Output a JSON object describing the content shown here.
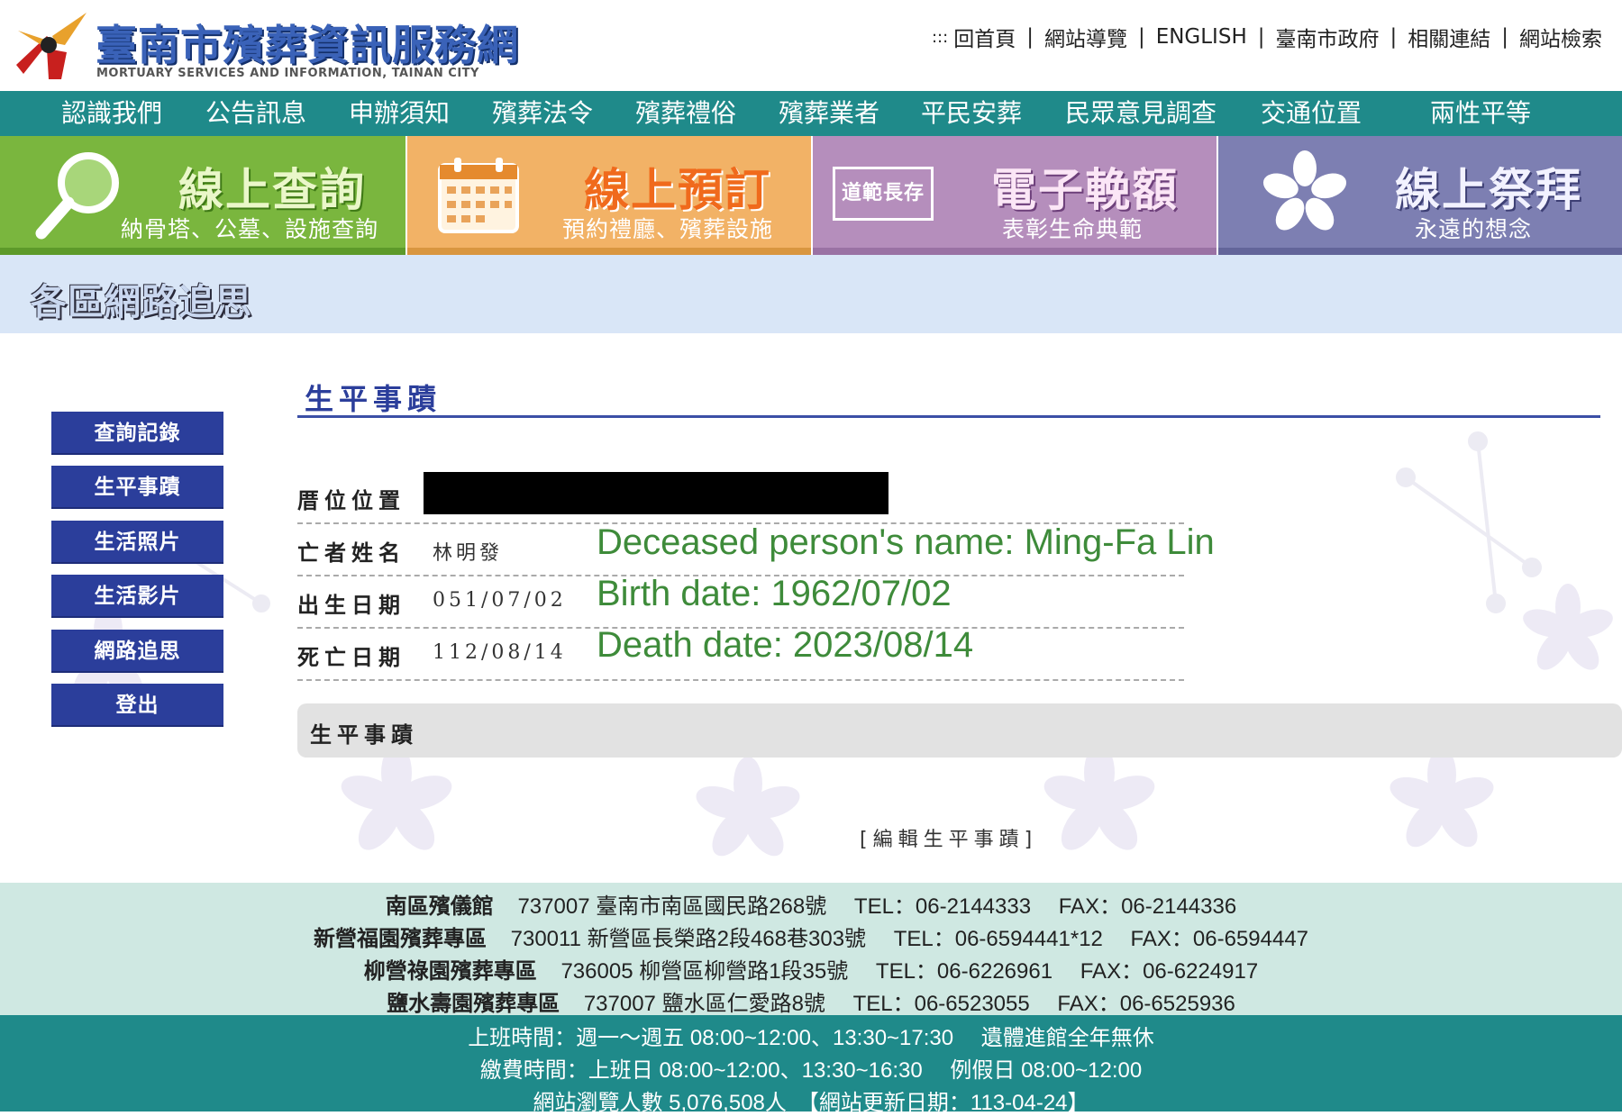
{
  "header": {
    "site_title": "臺南市殯葬資訊服務網",
    "site_subtitle": "MORTUARY SERVICES AND INFORMATION, TAINAN CITY",
    "top_prefix": ":::",
    "top_links": [
      "回首頁",
      "網站導覽",
      "ENGLISH",
      "臺南市政府",
      "相關連結",
      "網站檢索"
    ]
  },
  "nav": {
    "items": [
      "認識我們",
      "公告訊息",
      "申辦須知",
      "殯葬法令",
      "殯葬禮俗",
      "殯葬業者",
      "平民安葬",
      "民眾意見調查",
      "交通位置",
      "兩性平等"
    ]
  },
  "banners": [
    {
      "title": "線上查詢",
      "subtitle": "納骨塔、公墓、設施查詢"
    },
    {
      "title": "線上預訂",
      "subtitle": "預約禮廳、殯葬設施"
    },
    {
      "title": "電子輓額",
      "subtitle": "表彰生命典範",
      "badge": "道範長存"
    },
    {
      "title": "線上祭拜",
      "subtitle": "永遠的想念"
    }
  ],
  "section": {
    "title": "各區網路追思"
  },
  "sidebar": {
    "items": [
      "查詢記錄",
      "生平事蹟",
      "生活照片",
      "生活影片",
      "網路追思",
      "登出"
    ]
  },
  "main": {
    "title": "生平事蹟",
    "fields": [
      {
        "label": "厝位位置",
        "value": ""
      },
      {
        "label": "亡者姓名",
        "value": "林明發"
      },
      {
        "label": "出生日期",
        "value": "051/07/02"
      },
      {
        "label": "死亡日期",
        "value": "112/08/14"
      }
    ],
    "annotations": [
      "Deceased person's name: Ming-Fa Lin",
      "Birth date: 1962/07/02",
      "Death date: 2023/08/14"
    ],
    "bio_heading": "生平事蹟",
    "edit_link": "[編輯生平事蹟]"
  },
  "footer": {
    "locations": [
      {
        "name": "南區殯儀館",
        "text": "737007 臺南市南區國民路268號　 TEL：06-2144333　 FAX：06-2144336"
      },
      {
        "name": "新營福園殯葬專區",
        "text": "730011 新營區長榮路2段468巷303號　 TEL：06-6594441*12　 FAX：06-6594447"
      },
      {
        "name": "柳營祿園殯葬專區",
        "text": "736005 柳營區柳營路1段35號　 TEL：06-6226961　 FAX：06-6224917"
      },
      {
        "name": "鹽水壽園殯葬專區",
        "text": "737007 鹽水區仁愛路8號　 TEL：06-6523055　 FAX：06-6525936"
      }
    ],
    "hours": "上班時間：週一～週五 08:00~12:00、13:30~17:30　 遺體進館全年無休",
    "payment": "繳費時間：上班日 08:00~12:00、13:30~16:30　 例假日 08:00~12:00",
    "stats": "網站瀏覽人數 5,076,508人　【網站更新日期：113-04-24】"
  },
  "colors": {
    "nav": "#1f8a8a",
    "sidebar_button": "#2b3e9b",
    "annotation": "#3e8b3a"
  }
}
